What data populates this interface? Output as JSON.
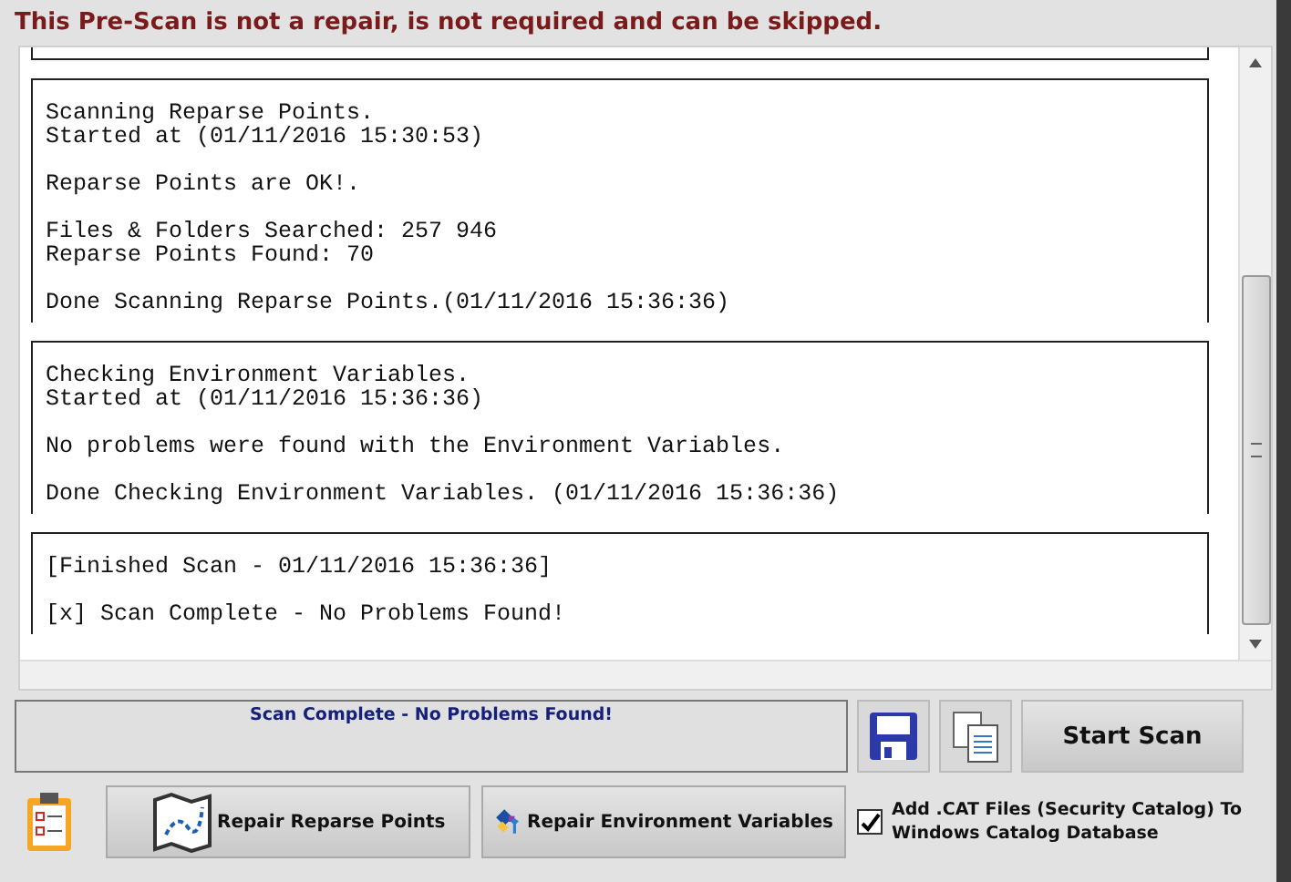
{
  "notice": "This Pre-Scan is not a repair, is not required and can be skipped.",
  "log_sections": [
    {
      "paragraphs": [
        [
          "Scanning Reparse Points.",
          "Started at (01/11/2016 15:30:53)"
        ],
        [
          "Reparse Points are OK!."
        ],
        [
          "Files & Folders Searched: 257 946",
          "Reparse Points Found: 70"
        ],
        [
          "Done Scanning Reparse Points.(01/11/2016 15:36:36)"
        ]
      ]
    },
    {
      "paragraphs": [
        [
          "Checking Environment Variables.",
          "Started at (01/11/2016 15:36:36)"
        ],
        [
          "No problems were found with the Environment Variables."
        ],
        [
          "Done Checking Environment Variables. (01/11/2016 15:36:36)"
        ]
      ]
    },
    {
      "paragraphs": [
        [
          "[Finished Scan - 01/11/2016 15:36:36]"
        ],
        [
          "[x] Scan Complete - No Problems Found!"
        ]
      ]
    }
  ],
  "status": "Scan Complete - No Problems Found!",
  "start_button": "Start Scan",
  "repair_buttons": [
    {
      "kind": "map",
      "label": "Repair Reparse Points"
    },
    {
      "kind": "tools",
      "label": "Repair Environment Variables"
    }
  ],
  "catalog_option": {
    "label": "Add .CAT Files (Security Catalog) To Windows Catalog Database",
    "checked": true
  }
}
